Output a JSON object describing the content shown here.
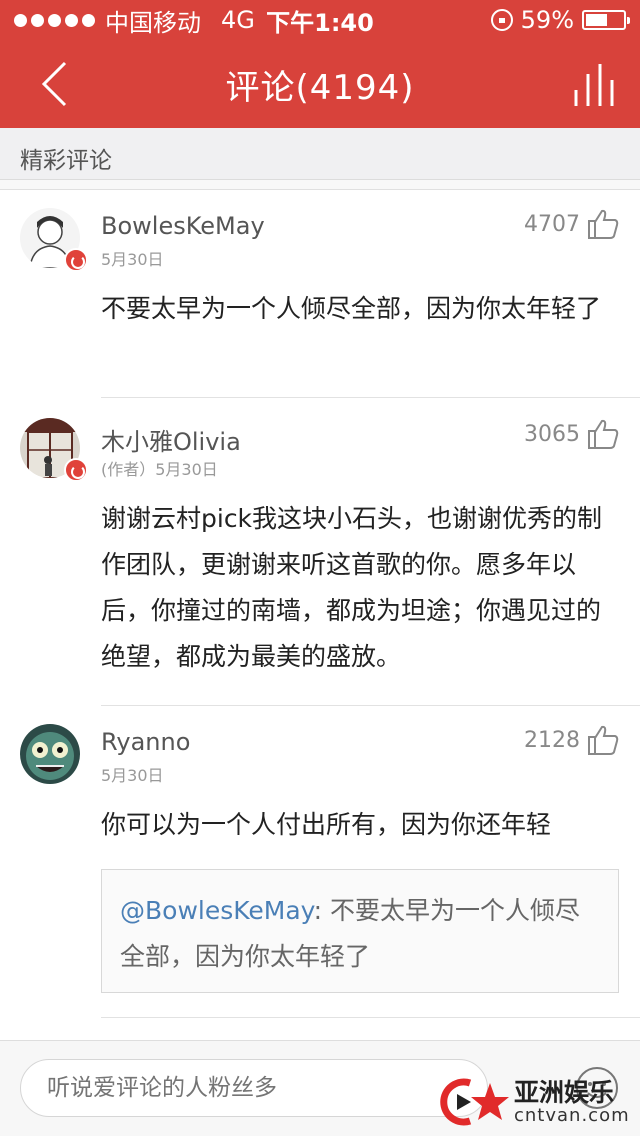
{
  "status_bar": {
    "carrier": "中国移动",
    "network": "4G",
    "time": "下午1:40",
    "battery": "59%",
    "battery_level": 0.59
  },
  "nav": {
    "title": "评论(4194)",
    "back_icon": "chevron-left-icon",
    "stats_icon": "bars-icon"
  },
  "section": {
    "title": "精彩评论"
  },
  "comments": [
    {
      "name": "BowlesKeMay",
      "date": "5月30日",
      "likes": "4707",
      "content": "不要太早为一个人倾尽全部，因为你太年轻了"
    },
    {
      "name": "木小雅Olivia",
      "date": "(作者）5月30日",
      "likes": "3065",
      "content": "谢谢云村pick我这块小石头，也谢谢优秀的制作团队，更谢谢来听这首歌的你。愿多年以后，你撞过的南墙，都成为坦途；你遇见过的绝望，都成为最美的盛放。"
    },
    {
      "name": "Ryanno",
      "date": "5月30日",
      "likes": "2128",
      "content": "你可以为一个人付出所有，因为你还年轻",
      "quote": {
        "mention": "@BowlesKeMay",
        "text": ": 不要太早为一个人倾尽全部，因为你太年轻了"
      }
    }
  ],
  "bottom": {
    "input_placeholder": "听说爱评论的人粉丝多"
  },
  "watermark": {
    "cn": "亚洲娱乐",
    "en": "cntvan.com"
  },
  "colors": {
    "brand_red": "#d8423b",
    "mention_blue": "#4a7fb6"
  }
}
